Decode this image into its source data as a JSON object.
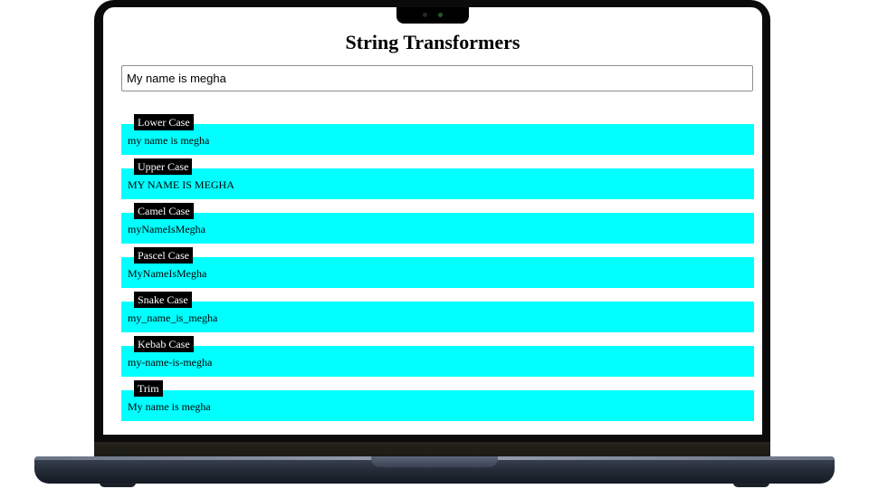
{
  "app": {
    "title": "String Transformers"
  },
  "input": {
    "value": "My name is megha"
  },
  "results": [
    {
      "label": "Lower Case",
      "value": "my name is megha"
    },
    {
      "label": "Upper Case",
      "value": "MY NAME IS MEGHA"
    },
    {
      "label": "Camel Case",
      "value": "myNameIsMegha"
    },
    {
      "label": "Pascel Case",
      "value": "MyNameIsMegha"
    },
    {
      "label": "Snake Case",
      "value": "my_name_is_megha"
    },
    {
      "label": "Kebab Case",
      "value": "my-name-is-megha"
    },
    {
      "label": "Trim",
      "value": "My name is megha"
    }
  ],
  "colors": {
    "result_background": "#00ffff",
    "label_background": "#000000",
    "label_text": "#ffffff"
  }
}
